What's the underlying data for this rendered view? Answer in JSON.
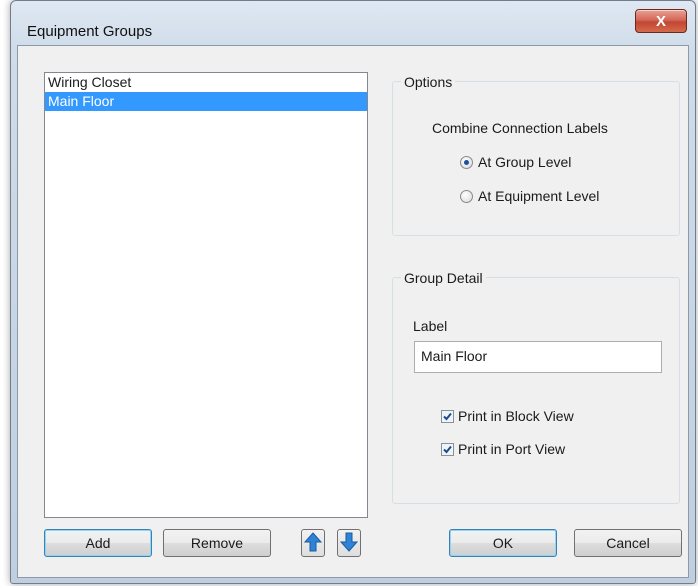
{
  "window": {
    "title": "Equipment Groups",
    "close_glyph": "X"
  },
  "groups_list": {
    "items": [
      "Wiring Closet",
      "Main Floor"
    ],
    "selected_index": 1
  },
  "options": {
    "legend": "Options",
    "combine_label": "Combine Connection Labels",
    "radios": [
      {
        "label": "At Group Level",
        "checked": true
      },
      {
        "label": "At Equipment Level",
        "checked": false
      }
    ]
  },
  "group_detail": {
    "legend": "Group Detail",
    "label_caption": "Label",
    "label_value": "Main Floor",
    "checkboxes": [
      {
        "label": "Print in Block View",
        "checked": true
      },
      {
        "label": "Print in Port View",
        "checked": true
      }
    ]
  },
  "buttons": {
    "add": "Add",
    "remove": "Remove",
    "ok": "OK",
    "cancel": "Cancel"
  },
  "icons": {
    "move_up": "arrow-up-icon",
    "move_down": "arrow-down-icon"
  },
  "colors": {
    "selection": "#3399ff",
    "arrow_blue": "#2f83d6"
  }
}
